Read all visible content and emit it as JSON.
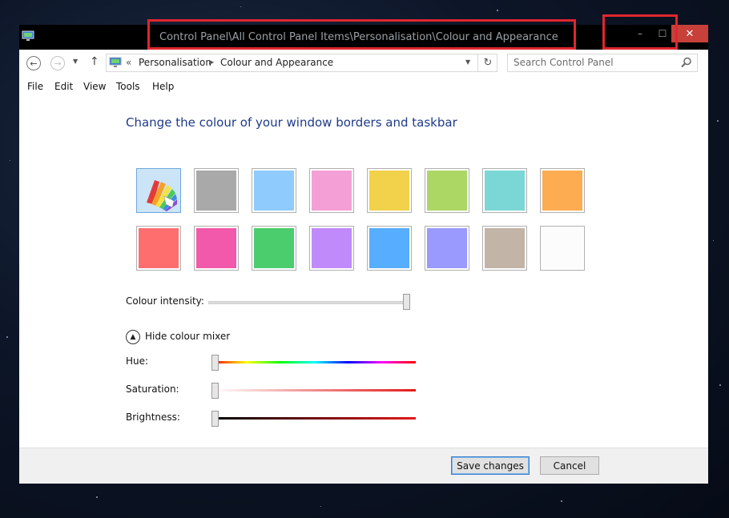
{
  "window": {
    "title": "Control Panel\\All Control Panel Items\\Personalisation\\Colour and Appearance",
    "close_glyph": "✕",
    "minimize_glyph": "–",
    "maximize_glyph": "☐"
  },
  "address_bar": {
    "overflow_glyph": "«",
    "crumbs": [
      "Personalisation",
      "Colour and Appearance"
    ],
    "search_placeholder": "Search Control Panel"
  },
  "menu": [
    "File",
    "Edit",
    "View",
    "Tools",
    "Help"
  ],
  "page": {
    "heading": "Change the colour of your window borders and taskbar",
    "swatches": [
      {
        "name": "automatic",
        "color": "auto",
        "selected": true
      },
      {
        "name": "grey",
        "color": "#a9a9a9"
      },
      {
        "name": "sky-blue",
        "color": "#8fcbfd"
      },
      {
        "name": "pink",
        "color": "#f4a0d6"
      },
      {
        "name": "yellow",
        "color": "#f1d24a"
      },
      {
        "name": "lime",
        "color": "#acd765"
      },
      {
        "name": "teal",
        "color": "#7bd7d5"
      },
      {
        "name": "orange",
        "color": "#fdac51"
      },
      {
        "name": "salmon",
        "color": "#fe6e6f"
      },
      {
        "name": "magenta",
        "color": "#f259aa"
      },
      {
        "name": "green",
        "color": "#4bcd6e"
      },
      {
        "name": "violet",
        "color": "#c08afb"
      },
      {
        "name": "blue",
        "color": "#57adfe"
      },
      {
        "name": "periwinkle",
        "color": "#9999fe"
      },
      {
        "name": "taupe",
        "color": "#c2b4a7"
      },
      {
        "name": "white",
        "color": "#fcfcfc"
      }
    ],
    "intensity_label": "Colour intensity:",
    "intensity_value": 1.0,
    "mixer_toggle_label": "Hide colour mixer",
    "hue_label": "Hue:",
    "hue_value": 0.0,
    "saturation_label": "Saturation:",
    "saturation_value": 0.0,
    "brightness_label": "Brightness:",
    "brightness_value": 0.0
  },
  "footer": {
    "save_label": "Save changes",
    "cancel_label": "Cancel"
  }
}
